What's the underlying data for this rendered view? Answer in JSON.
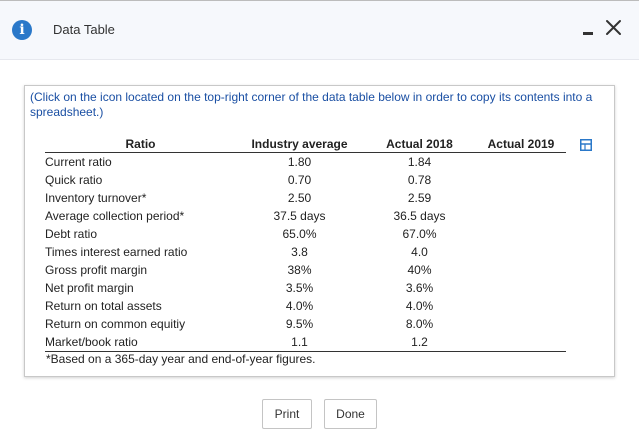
{
  "window": {
    "title": "Data Table",
    "icons": {
      "info": "info-icon",
      "minimize": "minimize-icon",
      "close": "close-icon",
      "copy": "copy-to-spreadsheet-icon"
    }
  },
  "instructions": "(Click on the icon located on the top-right corner of the data table below in order to copy its contents into a spreadsheet.)",
  "table": {
    "headers": [
      "Ratio",
      "Industry average",
      "Actual 2018",
      "Actual 2019"
    ],
    "rows": [
      {
        "ratio": "Current ratio",
        "industry": "1.80",
        "a2018": "1.84",
        "a2019": ""
      },
      {
        "ratio": "Quick ratio",
        "industry": "0.70",
        "a2018": "0.78",
        "a2019": ""
      },
      {
        "ratio": "Inventory turnover*",
        "industry": "2.50",
        "a2018": "2.59",
        "a2019": ""
      },
      {
        "ratio": "Average collection period*",
        "industry": "37.5 days",
        "a2018": "36.5 days",
        "a2019": ""
      },
      {
        "ratio": "Debt ratio",
        "industry": "65.0%",
        "a2018": "67.0%",
        "a2019": ""
      },
      {
        "ratio": "Times interest earned ratio",
        "industry": "3.8",
        "a2018": "4.0",
        "a2019": ""
      },
      {
        "ratio": "Gross profit margin",
        "industry": "38%",
        "a2018": "40%",
        "a2019": ""
      },
      {
        "ratio": "Net profit margin",
        "industry": "3.5%",
        "a2018": "3.6%",
        "a2019": ""
      },
      {
        "ratio": "Return on total assets",
        "industry": "4.0%",
        "a2018": "4.0%",
        "a2019": ""
      },
      {
        "ratio": "Return on common equitiy",
        "industry": "9.5%",
        "a2018": "8.0%",
        "a2019": ""
      },
      {
        "ratio": "Market/book ratio",
        "industry": "1.1",
        "a2018": "1.2",
        "a2019": ""
      }
    ],
    "footnote": "*Based on a 365-day year and end-of-year figures."
  },
  "buttons": {
    "print": "Print",
    "done": "Done"
  },
  "colors": {
    "info_icon": "#2a78c9",
    "instructions_text": "#1a4fa3",
    "copy_icon": "#2a78c9"
  }
}
